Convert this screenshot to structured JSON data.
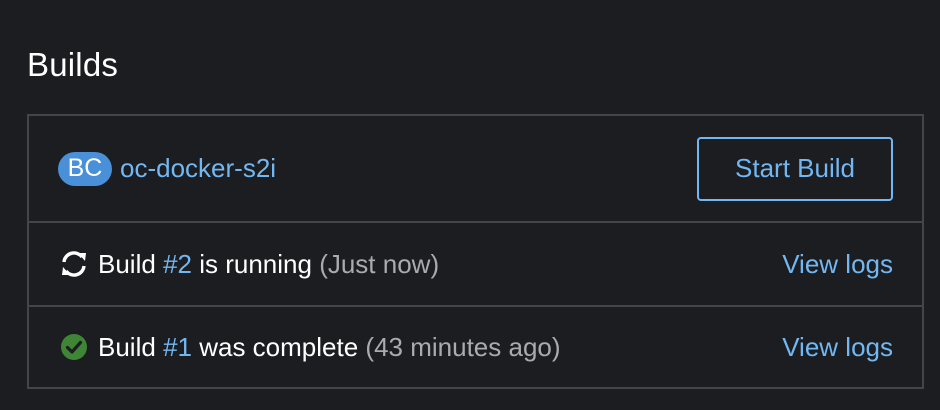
{
  "section": {
    "title": "Builds"
  },
  "build_config": {
    "badge": "BC",
    "name": "oc-docker-s2i",
    "start_button_label": "Start Build"
  },
  "builds": [
    {
      "prefix": "Build",
      "number": "#2",
      "status": "is running",
      "time": "(Just now)",
      "icon": "sync-icon",
      "logs_label": "View logs"
    },
    {
      "prefix": "Build",
      "number": "#1",
      "status": "was complete",
      "time": "(43 minutes ago)",
      "icon": "check-circle-icon",
      "logs_label": "View logs"
    }
  ],
  "colors": {
    "background": "#1b1d21",
    "link": "#73b7f2",
    "badge": "#4a90d9",
    "success": "#3e8635",
    "border": "#444548"
  }
}
